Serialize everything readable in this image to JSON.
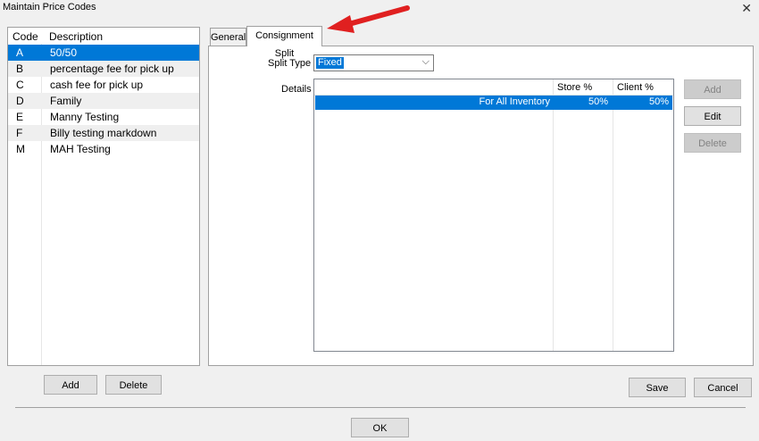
{
  "window": {
    "title": "Maintain Price Codes",
    "close_glyph": "✕"
  },
  "price_codes": {
    "headers": {
      "code": "Code",
      "description": "Description"
    },
    "rows": [
      {
        "code": "A",
        "description": "50/50"
      },
      {
        "code": "B",
        "description": "percentage fee for pick up"
      },
      {
        "code": "C",
        "description": "cash fee for pick up"
      },
      {
        "code": "D",
        "description": "Family"
      },
      {
        "code": "E",
        "description": "Manny Testing"
      },
      {
        "code": "F",
        "description": "Billy testing markdown"
      },
      {
        "code": "M",
        "description": "MAH Testing"
      }
    ],
    "selected_index": 0
  },
  "left_buttons": {
    "add": "Add",
    "delete": "Delete"
  },
  "tabs": [
    {
      "label": "General"
    },
    {
      "label": "Consignment Split"
    }
  ],
  "split_type": {
    "label": "Split Type",
    "value": "Fixed"
  },
  "details": {
    "label": "Details",
    "headers": {
      "store": "Store %",
      "client": "Client %"
    },
    "rows": [
      {
        "name": "For All Inventory",
        "store": "50%",
        "client": "50%"
      }
    ]
  },
  "detail_buttons": {
    "add": "Add",
    "edit": "Edit",
    "delete": "Delete"
  },
  "footer_buttons": {
    "save": "Save",
    "cancel": "Cancel",
    "ok": "OK"
  },
  "colors": {
    "selection": "#0078d7",
    "arrow": "#e02020"
  }
}
